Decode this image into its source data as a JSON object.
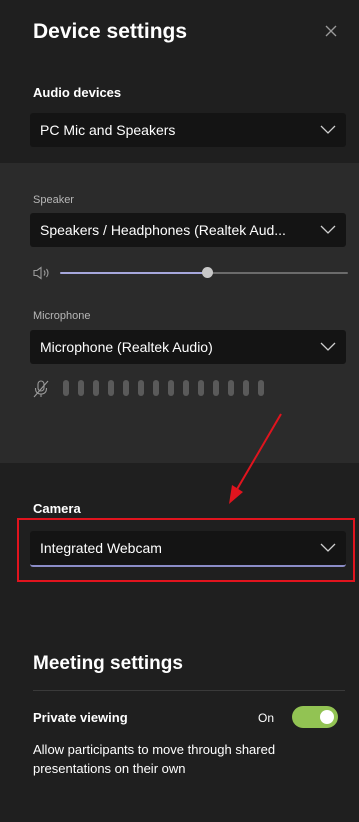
{
  "header": {
    "title": "Device settings",
    "close_icon": "close-icon"
  },
  "audio": {
    "section_label": "Audio devices",
    "device_selected": "PC Mic and Speakers",
    "speaker_label": "Speaker",
    "speaker_selected": "Speakers / Headphones (Realtek Aud...",
    "speaker_volume_fraction": 0.53,
    "microphone_label": "Microphone",
    "microphone_selected": "Microphone (Realtek Audio)",
    "mic_level_bars": 13
  },
  "camera": {
    "section_label": "Camera",
    "selected": "Integrated Webcam"
  },
  "meeting": {
    "title": "Meeting settings",
    "private_viewing_label": "Private viewing",
    "private_viewing_state": "On",
    "private_viewing_description": "Allow participants to move through shared presentations on their own"
  },
  "colors": {
    "panel_bg": "#1f1f1f",
    "subsection_bg": "#2b2b2b",
    "input_bg": "#141414",
    "accent": "#8b8cc7",
    "toggle_on": "#92c353",
    "annotation_red": "#e0141e"
  }
}
